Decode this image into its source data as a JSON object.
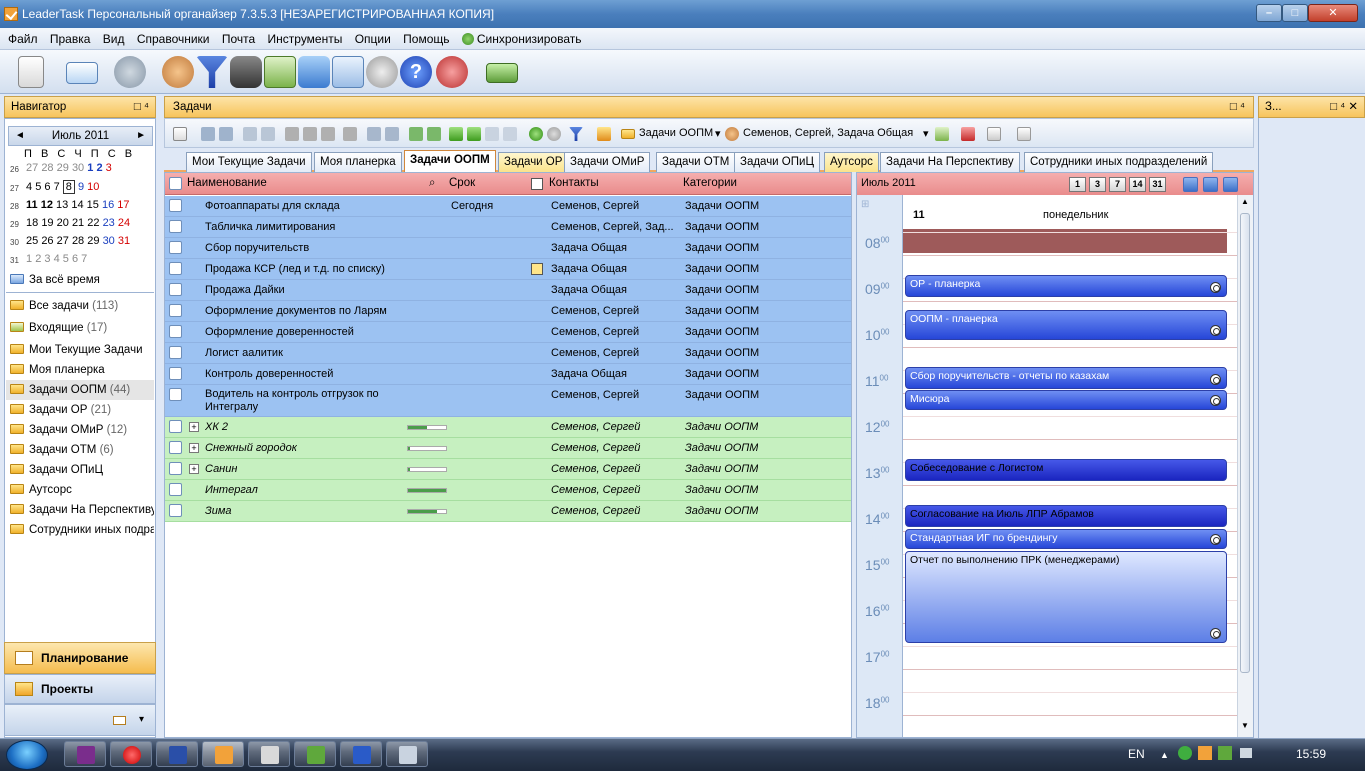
{
  "window": {
    "title": "LeaderTask Персональный органайзер 7.3.5.3 [НЕЗАРЕГИСТРИРОВАННАЯ КОПИЯ]",
    "minimize": "–",
    "maximize": "□",
    "close": "✕"
  },
  "menu": [
    "Файл",
    "Правка",
    "Вид",
    "Справочники",
    "Почта",
    "Инструменты",
    "Опции",
    "Помощь",
    "Синхронизировать"
  ],
  "navigator": {
    "title": "Навигатор",
    "pin": "□ ⁴",
    "month": "Июль 2011",
    "prev": "◄",
    "next": "►",
    "dow": "П В С Ч П С В",
    "weeks": [
      {
        "wk": "26",
        "days": [
          "27",
          "28",
          "29",
          "30",
          "1",
          "2",
          "3"
        ]
      },
      {
        "wk": "27",
        "days": [
          "4",
          "5",
          "6",
          "7",
          "8",
          "9",
          "10"
        ]
      },
      {
        "wk": "28",
        "days": [
          "11",
          "12",
          "13",
          "14",
          "15",
          "16",
          "17"
        ]
      },
      {
        "wk": "29",
        "days": [
          "18",
          "19",
          "20",
          "21",
          "22",
          "23",
          "24"
        ]
      },
      {
        "wk": "30",
        "days": [
          "25",
          "26",
          "27",
          "28",
          "29",
          "30",
          "31"
        ]
      },
      {
        "wk": "31",
        "days": [
          "1",
          "2",
          "3",
          "4",
          "5",
          "6",
          "7"
        ]
      }
    ],
    "all_time": "За всё время",
    "items": [
      {
        "label": "Все задачи",
        "count": "(113)"
      },
      {
        "label": "Входящие",
        "count": "(17)"
      },
      {
        "label": "Мои Текущие Задачи",
        "count": ""
      },
      {
        "label": "Моя планерка",
        "count": ""
      },
      {
        "label": "Задачи ООПМ",
        "count": "(44)"
      },
      {
        "label": "Задачи ОР",
        "count": "(21)"
      },
      {
        "label": "Задачи ОМиР",
        "count": "(12)"
      },
      {
        "label": "Задачи ОТМ",
        "count": "(6)"
      },
      {
        "label": "Задачи ОПиЦ",
        "count": ""
      },
      {
        "label": "Аутсорс",
        "count": ""
      },
      {
        "label": "Задачи На Перспективу",
        "count": ""
      },
      {
        "label": "Сотрудники иных подразделений",
        "count": ""
      }
    ],
    "planning": "Планирование",
    "projects": "Проекты",
    "footer_arrow": "▾"
  },
  "tasks": {
    "title": "Задачи",
    "pin": "□ ⁴",
    "toolbar": {
      "filter_folder": "Задачи ООПМ",
      "contacts_filter": "Семенов, Сергей, Задача Общая"
    },
    "tabs": [
      {
        "label": "Мои Текущие Задачи",
        "active": false,
        "yellow": false
      },
      {
        "label": "Моя планерка",
        "active": false,
        "yellow": false
      },
      {
        "label": "Задачи ООПМ",
        "active": true,
        "yellow": false
      },
      {
        "label": "Задачи ОР",
        "active": false,
        "yellow": true
      },
      {
        "label": "Задачи ОМиР",
        "active": false,
        "yellow": false
      },
      {
        "label": "Задачи ОТМ",
        "active": false,
        "yellow": false
      },
      {
        "label": "Задачи ОПиЦ",
        "active": false,
        "yellow": false
      },
      {
        "label": "Аутсорс",
        "active": false,
        "yellow": true
      },
      {
        "label": "Задачи На Перспективу",
        "active": false,
        "yellow": false
      },
      {
        "label": "Сотрудники иных подразделений",
        "active": false,
        "yellow": false
      }
    ],
    "columns": {
      "name": "Наименование",
      "due": "Срок",
      "contacts": "Контакты",
      "categories": "Категории"
    },
    "rows": [
      {
        "name": "Фотоаппараты для склада",
        "due": "Сегодня",
        "contacts": "Семенов, Сергей",
        "category": "Задачи ООПМ",
        "type": "blue",
        "progress": null,
        "expand": false,
        "note": false
      },
      {
        "name": "Табличка лимитирования",
        "due": "",
        "contacts": "Семенов, Сергей, Зад...",
        "category": "Задачи ООПМ",
        "type": "blue",
        "progress": null,
        "expand": false,
        "note": false
      },
      {
        "name": "Сбор поручительств",
        "due": "",
        "contacts": "Задача Общая",
        "category": "Задачи ООПМ",
        "type": "blue",
        "progress": null,
        "expand": false,
        "note": false
      },
      {
        "name": "Продажа КСР (лед и т.д. по списку)",
        "due": "",
        "contacts": "Задача Общая",
        "category": "Задачи ООПМ",
        "type": "blue",
        "progress": null,
        "expand": false,
        "note": true
      },
      {
        "name": "Продажа Дайки",
        "due": "",
        "contacts": "Задача Общая",
        "category": "Задачи ООПМ",
        "type": "blue",
        "progress": null,
        "expand": false,
        "note": false
      },
      {
        "name": "Оформление документов по Ларям",
        "due": "",
        "contacts": "Семенов, Сергей",
        "category": "Задачи ООПМ",
        "type": "blue",
        "progress": null,
        "expand": false,
        "note": false
      },
      {
        "name": "Оформление доверенностей",
        "due": "",
        "contacts": "Семенов, Сергей",
        "category": "Задачи ООПМ",
        "type": "blue",
        "progress": null,
        "expand": false,
        "note": false
      },
      {
        "name": "Логист аалитик",
        "due": "",
        "contacts": "Семенов, Сергей",
        "category": "Задачи ООПМ",
        "type": "blue",
        "progress": null,
        "expand": false,
        "note": false
      },
      {
        "name": "Контроль доверенностей",
        "due": "",
        "contacts": "Задача Общая",
        "category": "Задачи ООПМ",
        "type": "blue",
        "progress": null,
        "expand": false,
        "note": false
      },
      {
        "name": "Водитель на контроль отгрузок по Интегралу",
        "due": "",
        "contacts": "Семенов, Сергей",
        "category": "Задачи ООПМ",
        "type": "blue2",
        "progress": null,
        "expand": false,
        "note": false
      },
      {
        "name": "ХК 2",
        "due": "",
        "contacts": "Семенов, Сергей",
        "category": "Задачи ООПМ",
        "type": "green",
        "progress": 0.5,
        "expand": true,
        "note": false
      },
      {
        "name": "Снежный городок",
        "due": "",
        "contacts": "Семенов, Сергей",
        "category": "Задачи ООПМ",
        "type": "green",
        "progress": 0.05,
        "expand": true,
        "note": false
      },
      {
        "name": "Санин",
        "due": "",
        "contacts": "Семенов, Сергей",
        "category": "Задачи ООПМ",
        "type": "green",
        "progress": 0.05,
        "expand": true,
        "note": false
      },
      {
        "name": "Интергал",
        "due": "",
        "contacts": "Семенов, Сергей",
        "category": "Задачи ООПМ",
        "type": "green",
        "progress": 1.0,
        "expand": false,
        "note": false
      },
      {
        "name": "Зима",
        "due": "",
        "contacts": "Семенов, Сергей",
        "category": "Задачи ООПМ",
        "type": "green",
        "progress": 0.75,
        "expand": false,
        "note": false
      }
    ]
  },
  "schedule": {
    "month": "Июль 2011",
    "views": [
      "1",
      "3",
      "7",
      "14",
      "31"
    ],
    "day_num": "11",
    "day_name": "понедельник",
    "hours": [
      "08",
      "09",
      "10",
      "11",
      "12",
      "13",
      "14",
      "15",
      "16",
      "17",
      "18"
    ],
    "minutes": "00",
    "appointments": [
      {
        "title": "ОР - планерка",
        "style": "normal",
        "recurring": true
      },
      {
        "title": "ООПМ - планерка",
        "style": "normal",
        "recurring": true
      },
      {
        "title": "Сбор поручительств - отчеты по казахам",
        "style": "normal",
        "recurring": true
      },
      {
        "title": "Мисюра",
        "style": "normal",
        "recurring": true
      },
      {
        "title": "Собеседование с Логистом",
        "style": "dark",
        "recurring": false
      },
      {
        "title": "Согласование на Июль ЛПР Абрамов",
        "style": "dark",
        "recurring": false
      },
      {
        "title": "Стандартная ИГ по брендингу",
        "style": "normal",
        "recurring": true
      },
      {
        "title": "Отчет по выполнению ПРК (менеджерами)",
        "style": "light",
        "recurring": true
      }
    ]
  },
  "side_panel": {
    "title": "З...",
    "controls": "□ ⁴ ✕"
  },
  "taskbar": {
    "lang": "EN",
    "time": "15:59",
    "tray_arrow": "▲"
  }
}
